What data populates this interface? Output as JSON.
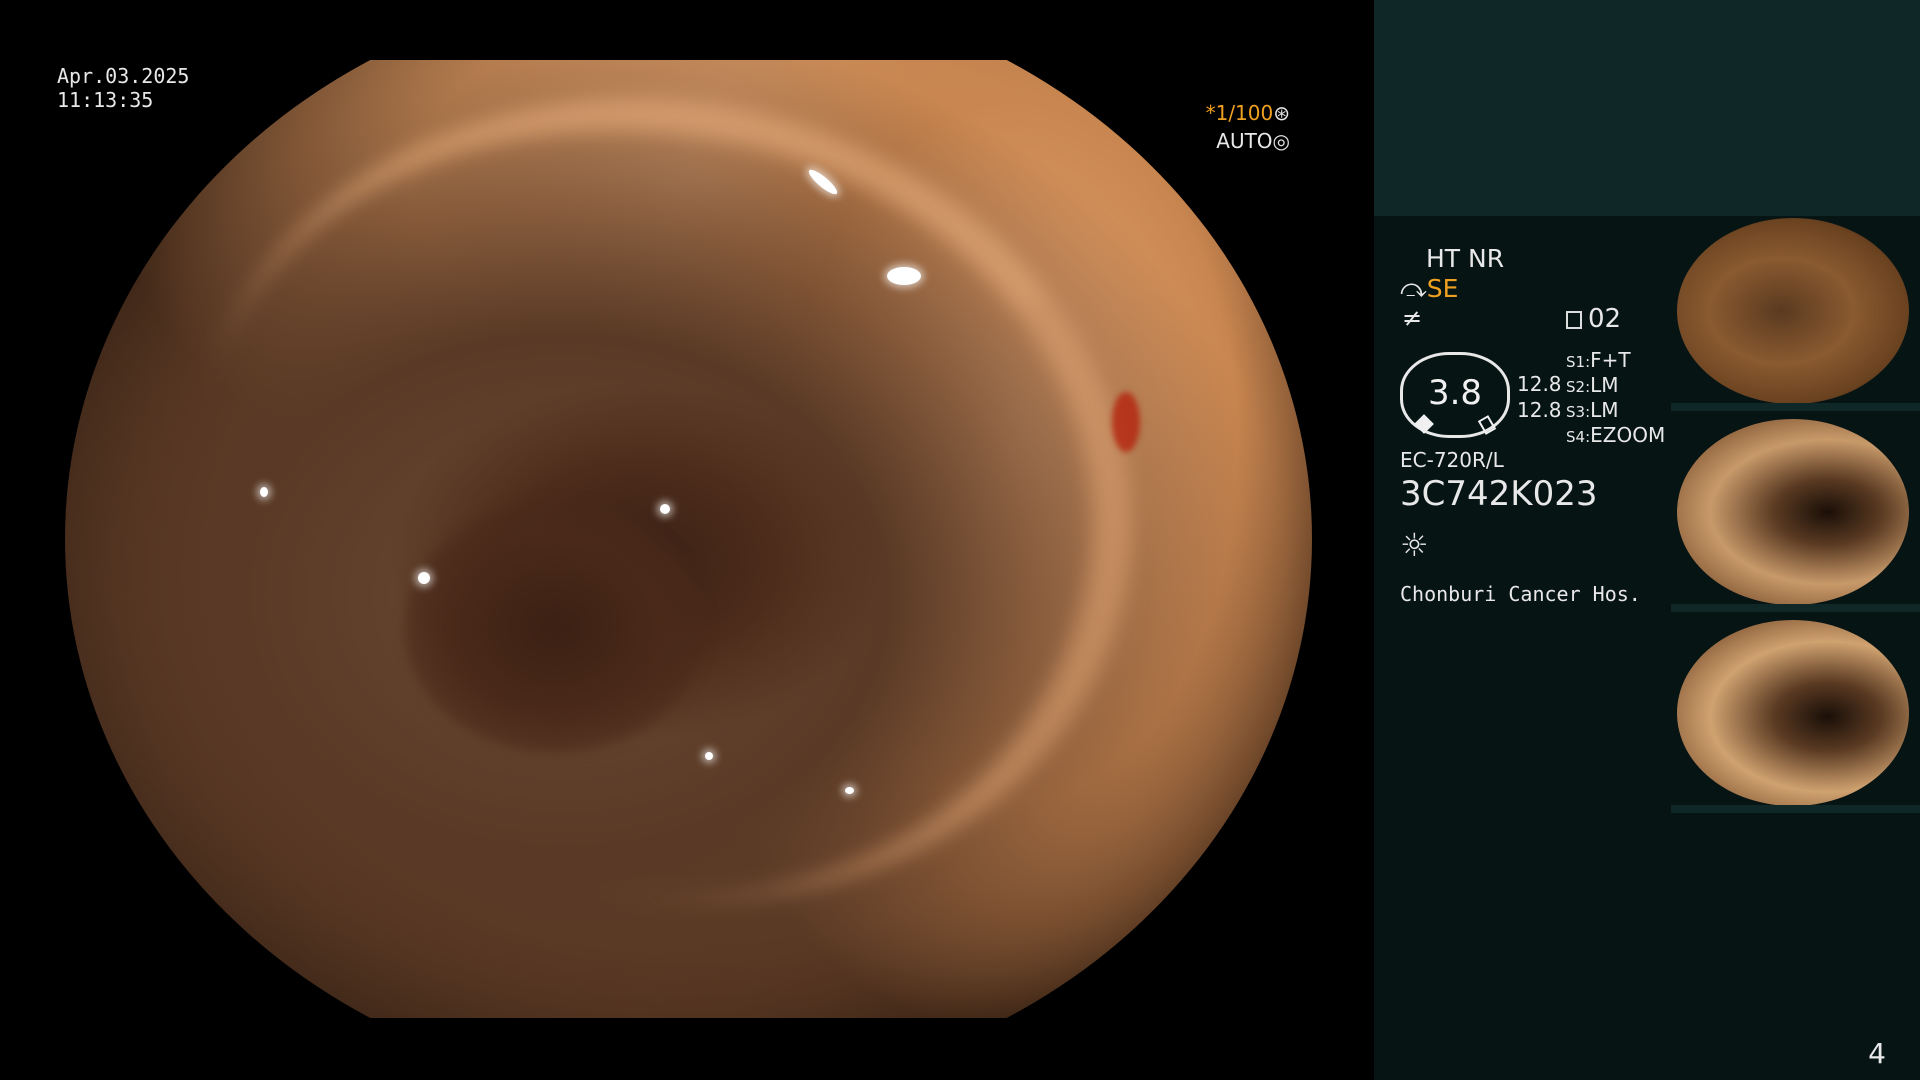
{
  "image_view": {
    "date": "Apr.03.2025",
    "time": "11:13:35",
    "shutter": "*1/100",
    "shutter_mode": "AUTO"
  },
  "panel": {
    "enhancement": "HT NR",
    "structure_mode": "SE",
    "record_number": "02",
    "gauge_value": "3.8",
    "gauge_side_1": "12.8",
    "gauge_side_2": "12.8",
    "switch_labels": [
      {
        "key": "S1:",
        "value": "F+T"
      },
      {
        "key": "S2:",
        "value": "LM"
      },
      {
        "key": "S3:",
        "value": "LM"
      },
      {
        "key": "S4:",
        "value": "EZOOM"
      }
    ],
    "scope_model": "EC-720R/L",
    "scope_serial": "3C742K023",
    "hospital": "Chonburi Cancer Hos."
  },
  "page_number": "4",
  "colors": {
    "accent_amber": "#f0a020",
    "panel_bg": "#061414",
    "panel_top_bg": "#0f2727"
  },
  "icons": {
    "shutter": "aperture-icon",
    "auto": "iris-icon",
    "structure": "lightning-pen-icon",
    "flat": "flat-line-icon",
    "record": "document-icon",
    "light": "sun-icon"
  }
}
